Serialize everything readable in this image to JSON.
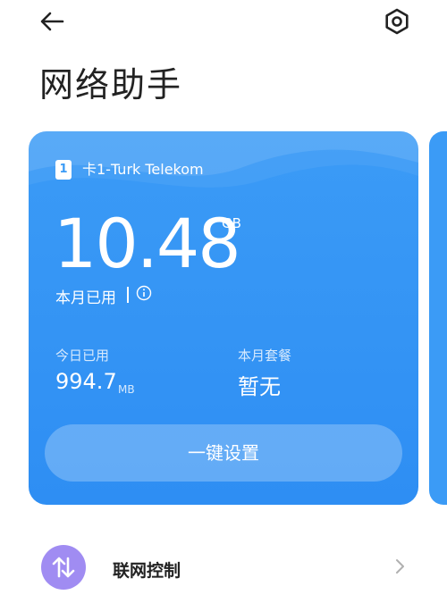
{
  "header": {
    "back_icon": "arrow-left-icon",
    "settings_icon": "gear-icon"
  },
  "page": {
    "title": "网络助手"
  },
  "card": {
    "sim_badge": "1",
    "sim_name": "卡1-Turk Telekom",
    "usage_value": "10.48",
    "usage_unit": "GB",
    "usage_label": "本月已用",
    "today_label": "今日已用",
    "today_value": "994.7",
    "today_unit": "MB",
    "plan_label": "本月套餐",
    "plan_value": "暂无",
    "setup_button": "一键设置",
    "accent_color": "#3b9bf6"
  },
  "list": {
    "network_control_label": "联网控制",
    "network_icon": "swap-vertical-icon",
    "network_icon_color": "#a08cf2"
  }
}
